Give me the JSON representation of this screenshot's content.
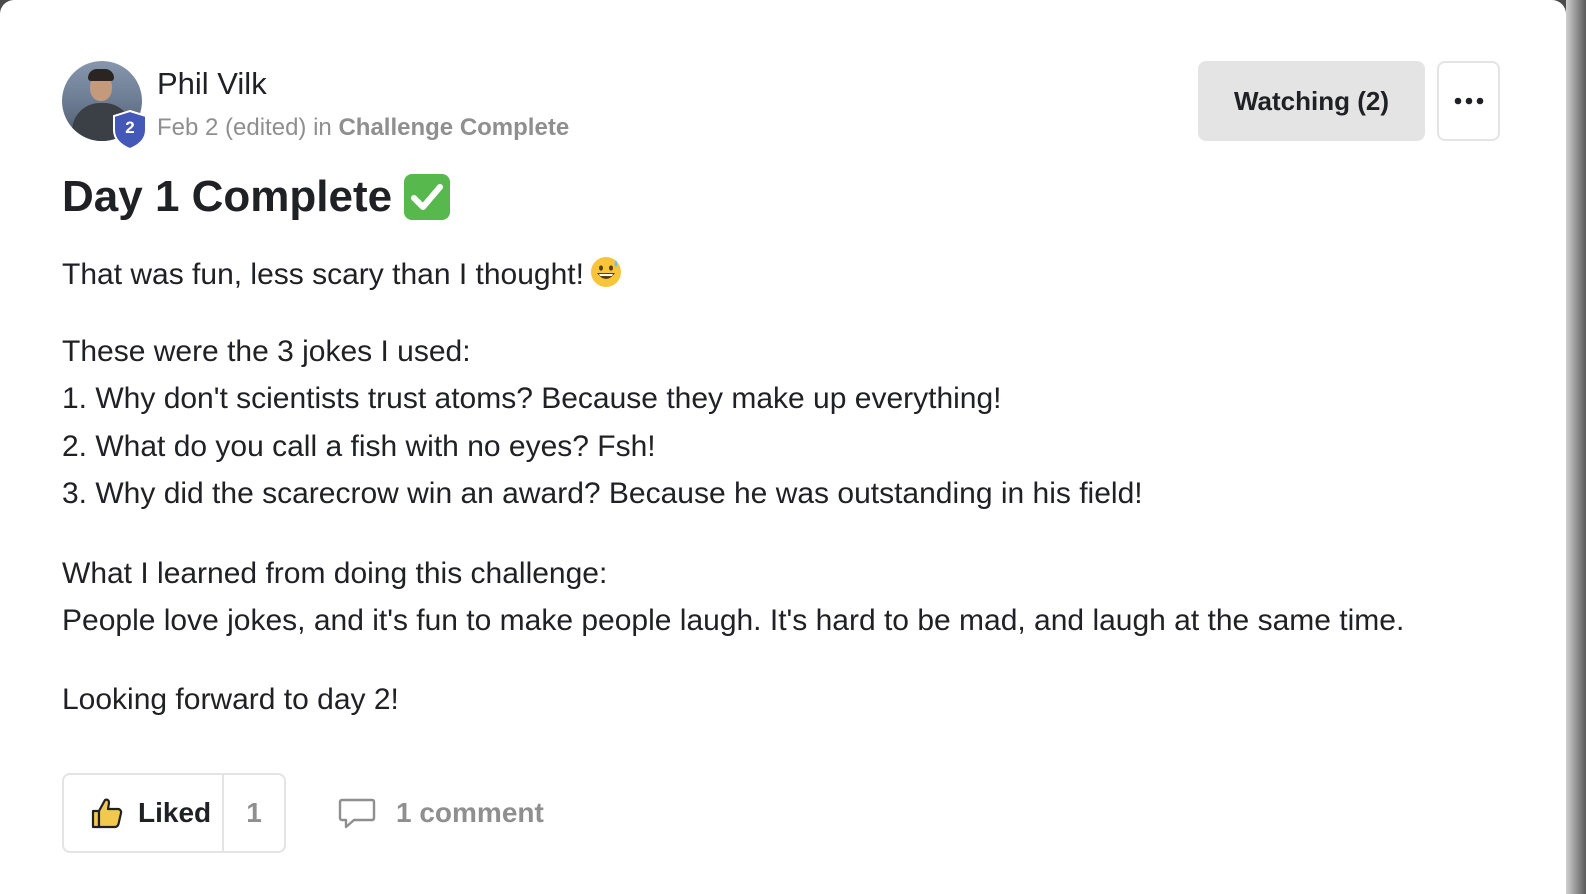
{
  "post": {
    "author": "Phil Vilk",
    "level": "2",
    "date": "Feb 2 (edited)",
    "in_text": "in",
    "group": "Challenge Complete",
    "title": "Day 1 Complete",
    "title_emoji_icon": "check-mark-button-icon",
    "body": {
      "line1": "That was fun, less scary than I thought!",
      "line1_emoji_icon": "grinning-sweat-face-icon",
      "jokes_intro": "These were the 3 jokes I used:",
      "joke1": "1. Why don't scientists trust atoms? Because they make up everything!",
      "joke2": "2. What do you call a fish with no eyes? Fsh!",
      "joke3": "3. Why did the scarecrow win an award? Because he was outstanding in his field!",
      "learned_intro": "What I learned from doing this challenge:",
      "learned": "People love jokes, and it's fun to make people laugh. It's hard to be mad, and laugh at the same time.",
      "closing": "Looking forward to day 2!"
    }
  },
  "header_actions": {
    "watching_label": "Watching (2)",
    "more_icon": "more-horizontal-icon"
  },
  "footer": {
    "like_label": "Liked",
    "like_count": "1",
    "like_icon": "thumbs-up-icon",
    "comment_label": "1 comment",
    "comment_icon": "comment-bubble-icon"
  },
  "colors": {
    "text": "#202124",
    "muted": "#8f8f8f",
    "badge": "#4458b8",
    "button_bg": "#e4e4e4",
    "like_icon": "#f2c94c"
  }
}
